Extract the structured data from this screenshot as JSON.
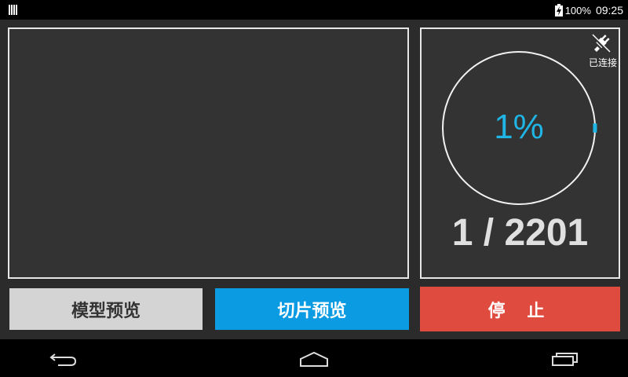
{
  "status_bar": {
    "battery": "100%",
    "time": "09:25"
  },
  "connection": {
    "label": "已连接",
    "icon": "plug-icon"
  },
  "progress": {
    "percent_text": "1%",
    "percent_value": 1,
    "layers_text": "1 / 2201",
    "accent_color": "#1fb6e6"
  },
  "buttons": {
    "model_preview": "模型预览",
    "slice_preview": "切片预览",
    "stop": "停 止"
  },
  "nav": {
    "back_icon": "back-icon",
    "home_icon": "home-icon",
    "recents_icon": "recents-icon"
  }
}
